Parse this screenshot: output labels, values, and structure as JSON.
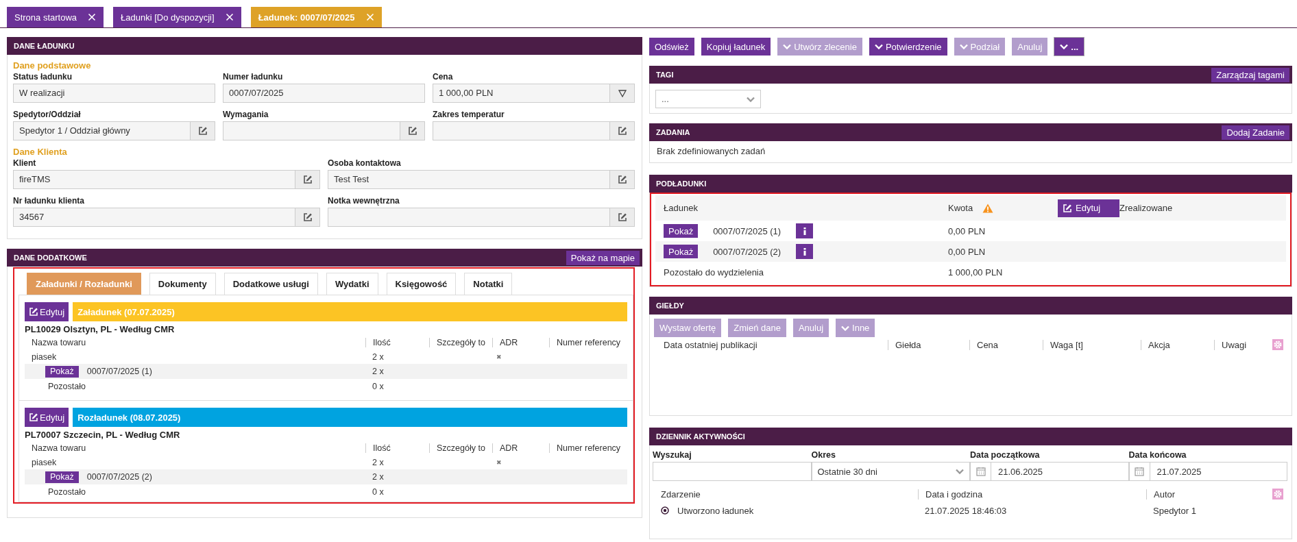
{
  "tabs": [
    {
      "label": "Strona startowa",
      "selected": false
    },
    {
      "label": "Ładunki [Do dyspozycji]",
      "selected": false
    },
    {
      "label": "Ładunek: 0007/07/2025",
      "selected": true
    }
  ],
  "load_details": {
    "title": "DANE ŁADUNKU",
    "groups": [
      {
        "heading": "Dane podstawowe",
        "rows": [
          [
            {
              "label": "Status ładunku",
              "value": "W realizacji",
              "kind": "plain"
            },
            {
              "label": "Numer ładunku",
              "value": "0007/07/2025",
              "kind": "plain"
            },
            {
              "label": "Cena",
              "value": "1 000,00 PLN",
              "kind": "filter"
            }
          ],
          [
            {
              "label": "Spedytor/Oddział",
              "value": "Spedytor 1 / Oddział główny",
              "kind": "edit"
            },
            {
              "label": "Wymagania",
              "kind": "edit"
            },
            {
              "label": "Zakres temperatur",
              "kind": "edit"
            }
          ]
        ]
      },
      {
        "heading": "Dane Klienta",
        "rows": [
          [
            {
              "label": "Klient",
              "value": "fireTMS",
              "kind": "edit"
            },
            {
              "label": "Osoba kontaktowa",
              "value": "Test Test",
              "kind": "edit"
            }
          ],
          [
            {
              "label": "Nr ładunku klienta",
              "value": "34567",
              "kind": "edit"
            },
            {
              "label": "Notka wewnętrzna",
              "kind": "edit"
            }
          ]
        ]
      }
    ]
  },
  "additional": {
    "title": "DANE DODATKOWE",
    "map_button": "Pokaż na mapie",
    "highlighted": true,
    "tabs": [
      {
        "label": "Załadunki / Rozładunki",
        "selected": true
      },
      {
        "label": "Dokumenty",
        "selected": false
      },
      {
        "label": "Dodatkowe usługi",
        "selected": false
      },
      {
        "label": "Wydatki",
        "selected": false
      },
      {
        "label": "Księgowość",
        "selected": false
      },
      {
        "label": "Notatki",
        "selected": false
      }
    ],
    "stops": [
      {
        "kind": "loading",
        "edit_label": "Edytuj",
        "title": "Załadunek (07.07.2025)",
        "address": "PL10029 Olsztyn, PL - Według CMR",
        "columns": [
          "Nazwa towaru",
          "Ilość",
          "Szczegóły to",
          "ADR",
          "Numer referency"
        ],
        "goods": [
          {
            "name": "piasek",
            "quantity": "2 x",
            "adr": "✖"
          }
        ],
        "subloads": [
          {
            "button": "Pokaż",
            "number": "0007/07/2025 (1)",
            "quantity": "2 x"
          }
        ],
        "remaining": {
          "label": "Pozostało",
          "quantity": "0 x"
        }
      },
      {
        "kind": "unloading",
        "edit_label": "Edytuj",
        "title": "Rozładunek (08.07.2025)",
        "address": "PL70007 Szczecin, PL - Według CMR",
        "columns": [
          "Nazwa towaru",
          "Ilość",
          "Szczegóły to",
          "ADR",
          "Numer referency"
        ],
        "goods": [
          {
            "name": "piasek",
            "quantity": "2 x",
            "adr": "✖"
          }
        ],
        "subloads": [
          {
            "button": "Pokaż",
            "number": "0007/07/2025 (2)",
            "quantity": "2 x"
          }
        ],
        "remaining": {
          "label": "Pozostało",
          "quantity": "0 x"
        }
      }
    ]
  },
  "actions": [
    {
      "label": "Odśwież",
      "disabled": false,
      "menu": false
    },
    {
      "label": "Kopiuj ładunek",
      "disabled": false,
      "menu": false
    },
    {
      "label": "Utwórz zlecenie",
      "disabled": true,
      "menu": true
    },
    {
      "label": "Potwierdzenie",
      "disabled": false,
      "menu": true
    },
    {
      "label": "Podział",
      "disabled": true,
      "menu": true
    },
    {
      "label": "Anuluj",
      "disabled": true,
      "menu": false
    },
    {
      "label": "...",
      "disabled": false,
      "menu": true
    }
  ],
  "tags": {
    "title": "TAGI",
    "button": "Zarządzaj tagami",
    "select": {
      "value": "..."
    }
  },
  "tasks": {
    "title": "ZADANIA",
    "button": "Dodaj Zadanie",
    "empty_text": "Brak zdefiniowanych zadań"
  },
  "subloads": {
    "title": "PODŁADUNKI",
    "highlighted": true,
    "columns": [
      {
        "label": "Ładunek",
        "warning": false
      },
      {
        "label": "Kwota",
        "warning": true
      },
      {
        "label": "Zrealizowane",
        "warning": false
      }
    ],
    "edit_button": "Edytuj",
    "rows": [
      {
        "button": "Pokaż",
        "number": "0007/07/2025 (1)",
        "amount": "0,00 PLN"
      },
      {
        "button": "Pokaż",
        "number": "0007/07/2025 (2)",
        "amount": "0,00 PLN"
      }
    ],
    "remaining": {
      "label": "Pozostało do wydzielenia",
      "amount": "1 000,00 PLN"
    }
  },
  "exchanges": {
    "title": "GIEŁDY",
    "buttons": [
      {
        "label": "Wystaw ofertę",
        "disabled": true,
        "menu": false
      },
      {
        "label": "Zmień dane",
        "disabled": true,
        "menu": false
      },
      {
        "label": "Anuluj",
        "disabled": true,
        "menu": false
      },
      {
        "label": "Inne",
        "disabled": true,
        "menu": true
      }
    ],
    "columns": [
      "Data ostatniej publikacji",
      "Giełda",
      "Cena",
      "Waga [t]",
      "Akcja",
      "Uwagi"
    ]
  },
  "activity": {
    "title": "DZIENNIK AKTYWNOŚCI",
    "filters": {
      "search": {
        "label": "Wyszukaj"
      },
      "period": {
        "label": "Okres",
        "value": "Ostatnie 30 dni"
      },
      "start": {
        "label": "Data początkowa",
        "value": "21.06.2025"
      },
      "end": {
        "label": "Data końcowa",
        "value": "21.07.2025"
      }
    },
    "columns": [
      "Zdarzenie",
      "Data i godzina",
      "Autor"
    ],
    "rows": [
      {
        "event": "Utworzono ładunek",
        "datetime": "21.07.2025 18:46:03",
        "author": "Spedytor 1"
      }
    ]
  }
}
